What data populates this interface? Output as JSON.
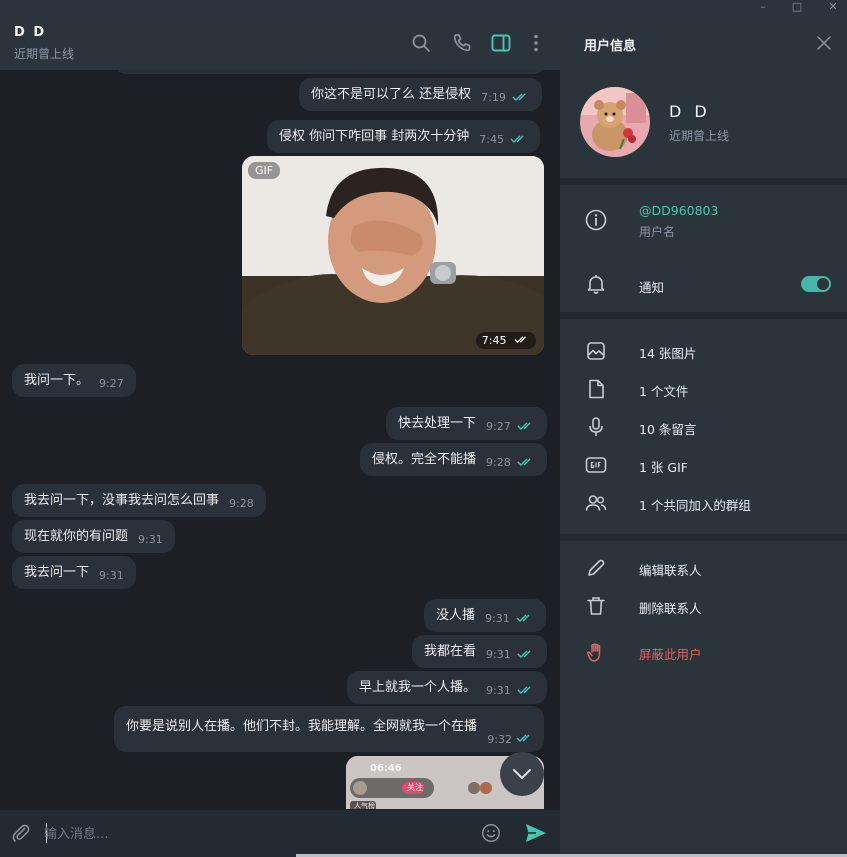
{
  "chat_header": {
    "name": "D D",
    "status": "近期曾上线"
  },
  "messages": [
    {
      "dir": "out",
      "text": "你这不是可以了么  还是侵权",
      "time": "7:19"
    },
    {
      "dir": "out",
      "text": "侵权  你问下咋回事  封两次十分钟",
      "time": "7:45"
    },
    {
      "dir": "out",
      "type": "gif",
      "badge": "GIF",
      "time": "7:45"
    },
    {
      "dir": "in",
      "text": "我问一下。",
      "time": "9:27"
    },
    {
      "dir": "out",
      "text": "快去处理一下",
      "time": "9:27"
    },
    {
      "dir": "out",
      "text": "侵权。完全不能播",
      "time": "9:28"
    },
    {
      "dir": "in",
      "text": "我去问一下，没事我去问怎么回事",
      "time": "9:28"
    },
    {
      "dir": "in",
      "text": "现在就你的有问题",
      "time": "9:31"
    },
    {
      "dir": "in",
      "text": "我去问一下",
      "time": "9:31"
    },
    {
      "dir": "out",
      "text": "没人播",
      "time": "9:31"
    },
    {
      "dir": "out",
      "text": "我都在看",
      "time": "9:31"
    },
    {
      "dir": "out",
      "text": "早上就我一个人播。",
      "time": "9:31"
    },
    {
      "dir": "out",
      "text": "你要是说别人在播。他们不封。我能理解。全网就我一个在播",
      "time": "9:32"
    }
  ],
  "phone_preview": {
    "time": "06:46",
    "tag": "关注",
    "label": "人气榜"
  },
  "composer": {
    "placeholder": "输入消息..."
  },
  "info_panel": {
    "title": "用户信息",
    "name": "D D",
    "status": "近期曾上线",
    "username": "@DD960803",
    "username_label": "用户名",
    "notifications_label": "通知",
    "notifications_on": true,
    "media": [
      {
        "icon": "photo-icon",
        "label": "14 张图片"
      },
      {
        "icon": "file-icon",
        "label": "1 个文件"
      },
      {
        "icon": "microphone-icon",
        "label": "10 条留言"
      },
      {
        "icon": "gif-icon",
        "label": "1 张 GIF"
      },
      {
        "icon": "group-icon",
        "label": "1 个共同加入的群组"
      }
    ],
    "actions": {
      "edit": "编辑联系人",
      "delete": "删除联系人",
      "block": "屏蔽此用户"
    }
  },
  "colors": {
    "accent": "#46c7b3",
    "danger": "#e0635f",
    "bubble": "#2b3138",
    "chat_bg": "#1c1f24",
    "panel_bg": "#2b333b"
  }
}
